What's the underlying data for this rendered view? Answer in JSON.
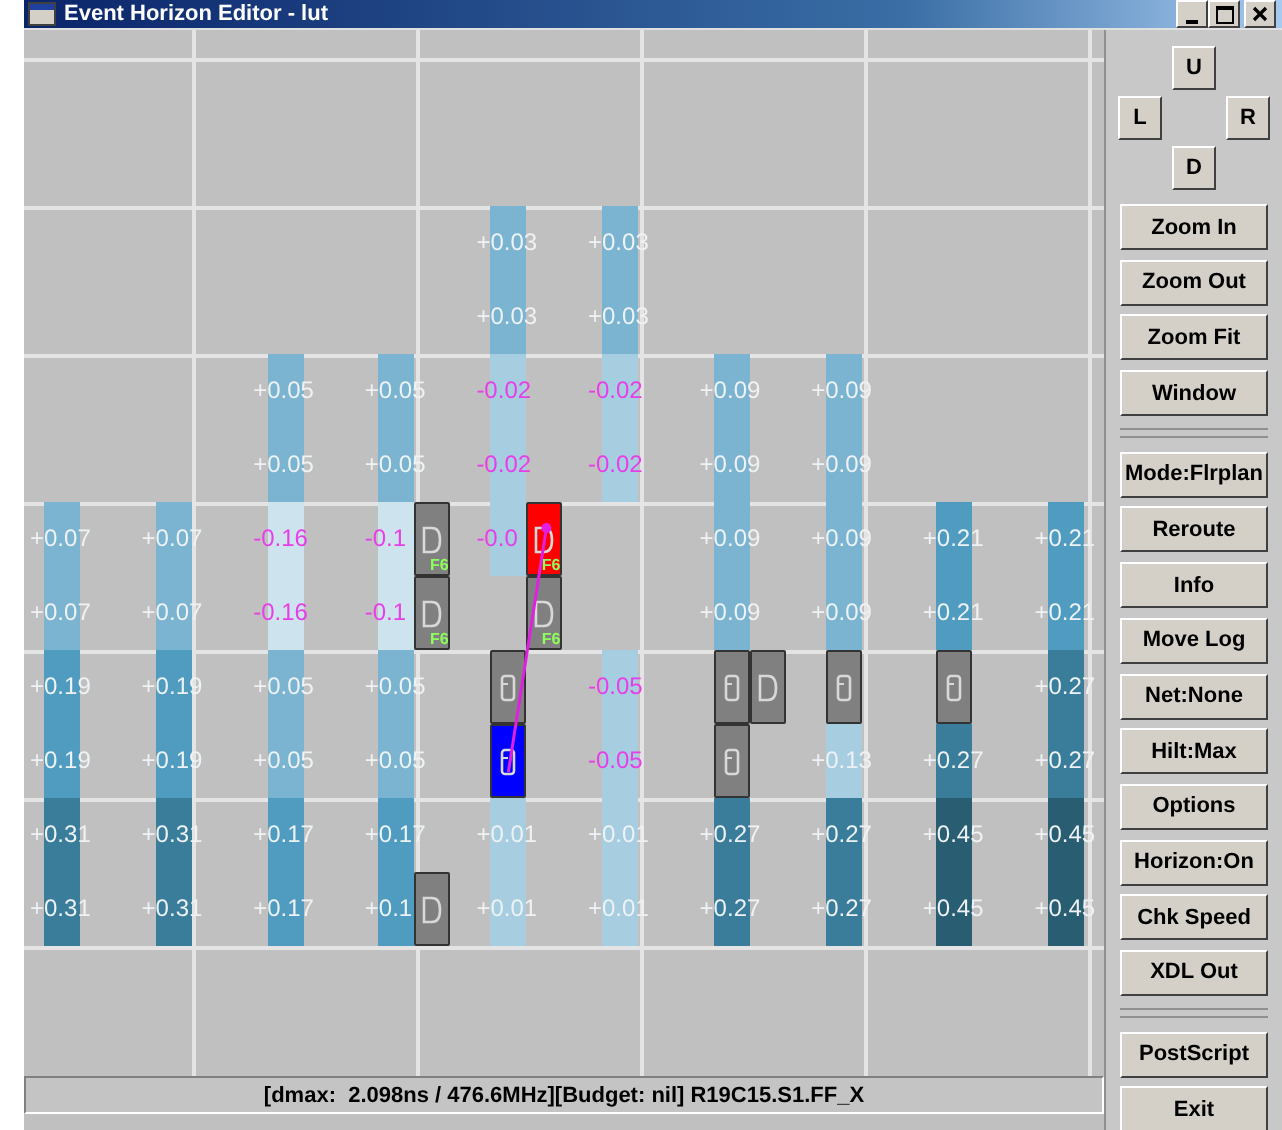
{
  "window": {
    "title": "Event Horizon Editor - lut"
  },
  "columns": [
    {
      "cells": [
        {
          "kind": "empty"
        },
        {
          "kind": "empty"
        },
        {
          "kind": "empty"
        },
        {
          "kind": "empty"
        },
        {
          "kind": "empty"
        },
        {
          "kind": "empty"
        },
        {
          "kind": "bar",
          "value": "+0.07",
          "color": "#7ab4d0",
          "negative": false
        },
        {
          "kind": "bar",
          "value": "+0.07",
          "color": "#7ab4d0",
          "negative": false
        },
        {
          "kind": "bar",
          "value": "+0.19",
          "color": "#4f9cc0",
          "negative": false
        },
        {
          "kind": "bar",
          "value": "+0.19",
          "color": "#4f9cc0",
          "negative": false
        },
        {
          "kind": "bar",
          "value": "+0.31",
          "color": "#3a7d9b",
          "negative": false
        },
        {
          "kind": "bar",
          "value": "+0.31",
          "color": "#3a7d9b",
          "negative": false
        }
      ]
    },
    {
      "cells": [
        {
          "kind": "empty"
        },
        {
          "kind": "empty"
        },
        {
          "kind": "empty"
        },
        {
          "kind": "empty"
        },
        {
          "kind": "empty"
        },
        {
          "kind": "empty"
        },
        {
          "kind": "bar",
          "value": "+0.07",
          "color": "#7ab4d0",
          "negative": false
        },
        {
          "kind": "bar",
          "value": "+0.07",
          "color": "#7ab4d0",
          "negative": false
        },
        {
          "kind": "bar",
          "value": "+0.19",
          "color": "#4f9cc0",
          "negative": false
        },
        {
          "kind": "bar",
          "value": "+0.19",
          "color": "#4f9cc0",
          "negative": false
        },
        {
          "kind": "bar",
          "value": "+0.31",
          "color": "#3a7d9b",
          "negative": false
        },
        {
          "kind": "bar",
          "value": "+0.31",
          "color": "#3a7d9b",
          "negative": false
        }
      ]
    },
    {
      "cells": [
        {
          "kind": "empty"
        },
        {
          "kind": "empty"
        },
        {
          "kind": "empty"
        },
        {
          "kind": "empty"
        },
        {
          "kind": "bar",
          "value": "+0.05",
          "color": "#7ab4d0",
          "negative": false
        },
        {
          "kind": "bar",
          "value": "+0.05",
          "color": "#7ab4d0",
          "negative": false
        },
        {
          "kind": "bar",
          "value": "-0.16",
          "color": "#cde3ed",
          "negative": true
        },
        {
          "kind": "bar",
          "value": "-0.16",
          "color": "#cde3ed",
          "negative": true
        },
        {
          "kind": "bar",
          "value": "+0.05",
          "color": "#7ab4d0",
          "negative": false
        },
        {
          "kind": "bar",
          "value": "+0.05",
          "color": "#7ab4d0",
          "negative": false
        },
        {
          "kind": "bar",
          "value": "+0.17",
          "color": "#4f9cc0",
          "negative": false
        },
        {
          "kind": "bar",
          "value": "+0.17",
          "color": "#4f9cc0",
          "negative": false
        }
      ]
    },
    {
      "cells": [
        {
          "kind": "empty"
        },
        {
          "kind": "empty"
        },
        {
          "kind": "empty"
        },
        {
          "kind": "empty"
        },
        {
          "kind": "bar",
          "value": "+0.05",
          "color": "#7ab4d0",
          "negative": false
        },
        {
          "kind": "bar",
          "value": "+0.05",
          "color": "#7ab4d0",
          "negative": false
        },
        {
          "kind": "bar",
          "value": "-0.1",
          "color": "#cde3ed",
          "negative": true,
          "beside": {
            "kind": "buffer",
            "color": "#808080",
            "tag": "F6",
            "on_net": false
          }
        },
        {
          "kind": "bar",
          "value": "-0.1",
          "color": "#cde3ed",
          "negative": true,
          "beside": {
            "kind": "buffer",
            "color": "#808080",
            "tag": "F6",
            "on_net": false
          }
        },
        {
          "kind": "bar",
          "value": "+0.05",
          "color": "#7ab4d0",
          "negative": false
        },
        {
          "kind": "bar",
          "value": "+0.05",
          "color": "#7ab4d0",
          "negative": false
        },
        {
          "kind": "bar",
          "value": "+0.17",
          "color": "#4f9cc0",
          "negative": false
        },
        {
          "kind": "bar",
          "value": "+0.1",
          "color": "#4f9cc0",
          "negative": false,
          "beside": {
            "kind": "buffer",
            "color": "#808080",
            "on_net": false
          }
        }
      ]
    },
    {
      "cells": [
        {
          "kind": "empty"
        },
        {
          "kind": "empty"
        },
        {
          "kind": "bar",
          "value": "+0.03",
          "color": "#7ab4d0",
          "negative": false
        },
        {
          "kind": "bar",
          "value": "+0.03",
          "color": "#7ab4d0",
          "negative": false
        },
        {
          "kind": "bar",
          "value": "-0.02",
          "color": "#a6cde0",
          "negative": true
        },
        {
          "kind": "bar",
          "value": "-0.02",
          "color": "#a6cde0",
          "negative": true
        },
        {
          "kind": "bar",
          "value": "-0.0",
          "color": "#a6cde0",
          "negative": true,
          "beside": {
            "kind": "buffer",
            "color": "#ff0000",
            "tag": "F6",
            "on_net": true
          }
        },
        {
          "kind": "empty",
          "beside": {
            "kind": "buffer",
            "color": "#808080",
            "tag": "F6",
            "on_net": false
          }
        },
        {
          "kind": "latch",
          "color": "#808080",
          "on_net": false
        },
        {
          "kind": "latch",
          "color": "#0000ff",
          "on_net": true
        },
        {
          "kind": "bar",
          "value": "+0.01",
          "color": "#a6cde0",
          "negative": false
        },
        {
          "kind": "bar",
          "value": "+0.01",
          "color": "#a6cde0",
          "negative": false
        }
      ]
    },
    {
      "cells": [
        {
          "kind": "empty"
        },
        {
          "kind": "empty"
        },
        {
          "kind": "bar",
          "value": "+0.03",
          "color": "#7ab4d0",
          "negative": false
        },
        {
          "kind": "bar",
          "value": "+0.03",
          "color": "#7ab4d0",
          "negative": false
        },
        {
          "kind": "bar",
          "value": "-0.02",
          "color": "#a6cde0",
          "negative": true
        },
        {
          "kind": "bar",
          "value": "-0.02",
          "color": "#a6cde0",
          "negative": true
        },
        {
          "kind": "empty"
        },
        {
          "kind": "empty"
        },
        {
          "kind": "bar",
          "value": "-0.05",
          "color": "#a6cde0",
          "negative": true
        },
        {
          "kind": "bar",
          "value": "-0.05",
          "color": "#a6cde0",
          "negative": true
        },
        {
          "kind": "bar",
          "value": "+0.01",
          "color": "#a6cde0",
          "negative": false
        },
        {
          "kind": "bar",
          "value": "+0.01",
          "color": "#a6cde0",
          "negative": false
        }
      ]
    },
    {
      "cells": [
        {
          "kind": "empty"
        },
        {
          "kind": "empty"
        },
        {
          "kind": "empty"
        },
        {
          "kind": "empty"
        },
        {
          "kind": "bar",
          "value": "+0.09",
          "color": "#7ab4d0",
          "negative": false
        },
        {
          "kind": "bar",
          "value": "+0.09",
          "color": "#7ab4d0",
          "negative": false
        },
        {
          "kind": "bar",
          "value": "+0.09",
          "color": "#7ab4d0",
          "negative": false
        },
        {
          "kind": "bar",
          "value": "+0.09",
          "color": "#7ab4d0",
          "negative": false
        },
        {
          "kind": "latch",
          "color": "#808080",
          "on_net": false,
          "beside": {
            "kind": "buffer",
            "color": "#808080",
            "on_net": false
          }
        },
        {
          "kind": "latch",
          "color": "#808080",
          "on_net": false
        },
        {
          "kind": "bar",
          "value": "+0.27",
          "color": "#3a7d9b",
          "negative": false
        },
        {
          "kind": "bar",
          "value": "+0.27",
          "color": "#3a7d9b",
          "negative": false
        }
      ]
    },
    {
      "cells": [
        {
          "kind": "empty"
        },
        {
          "kind": "empty"
        },
        {
          "kind": "empty"
        },
        {
          "kind": "empty"
        },
        {
          "kind": "bar",
          "value": "+0.09",
          "color": "#7ab4d0",
          "negative": false
        },
        {
          "kind": "bar",
          "value": "+0.09",
          "color": "#7ab4d0",
          "negative": false
        },
        {
          "kind": "bar",
          "value": "+0.09",
          "color": "#7ab4d0",
          "negative": false
        },
        {
          "kind": "bar",
          "value": "+0.09",
          "color": "#7ab4d0",
          "negative": false
        },
        {
          "kind": "latch",
          "color": "#808080",
          "on_net": false
        },
        {
          "kind": "bar",
          "value": "+0.13",
          "color": "#a6cde0",
          "negative": false
        },
        {
          "kind": "bar",
          "value": "+0.27",
          "color": "#3a7d9b",
          "negative": false
        },
        {
          "kind": "bar",
          "value": "+0.27",
          "color": "#3a7d9b",
          "negative": false
        }
      ]
    },
    {
      "cells": [
        {
          "kind": "empty"
        },
        {
          "kind": "empty"
        },
        {
          "kind": "empty"
        },
        {
          "kind": "empty"
        },
        {
          "kind": "empty"
        },
        {
          "kind": "empty"
        },
        {
          "kind": "bar",
          "value": "+0.21",
          "color": "#4f9cc0",
          "negative": false
        },
        {
          "kind": "bar",
          "value": "+0.21",
          "color": "#4f9cc0",
          "negative": false
        },
        {
          "kind": "latch",
          "color": "#808080",
          "on_net": false
        },
        {
          "kind": "bar",
          "value": "+0.27",
          "color": "#3a7d9b",
          "negative": false
        },
        {
          "kind": "bar",
          "value": "+0.45",
          "color": "#285d72",
          "negative": false
        },
        {
          "kind": "bar",
          "value": "+0.45",
          "color": "#285d72",
          "negative": false
        }
      ]
    },
    {
      "cells": [
        {
          "kind": "empty"
        },
        {
          "kind": "empty"
        },
        {
          "kind": "empty"
        },
        {
          "kind": "empty"
        },
        {
          "kind": "empty"
        },
        {
          "kind": "empty"
        },
        {
          "kind": "bar",
          "value": "+0.21",
          "color": "#4f9cc0",
          "negative": false
        },
        {
          "kind": "bar",
          "value": "+0.21",
          "color": "#4f9cc0",
          "negative": false
        },
        {
          "kind": "bar",
          "value": "+0.27",
          "color": "#3a7d9b",
          "negative": false
        },
        {
          "kind": "bar",
          "value": "+0.27",
          "color": "#3a7d9b",
          "negative": false
        },
        {
          "kind": "bar",
          "value": "+0.45",
          "color": "#285d72",
          "negative": false
        },
        {
          "kind": "bar",
          "value": "+0.45",
          "color": "#285d72",
          "negative": false
        }
      ]
    }
  ],
  "pad": {
    "up": "U",
    "left": "L",
    "right": "R",
    "down": "D"
  },
  "controls": [
    {
      "kind": "button",
      "label": "Zoom In"
    },
    {
      "kind": "button",
      "label": "Zoom Out"
    },
    {
      "kind": "button",
      "label": "Zoom Fit"
    },
    {
      "kind": "button",
      "label": "Window"
    },
    {
      "kind": "separator"
    },
    {
      "kind": "button",
      "label": "Mode:Flrplan"
    },
    {
      "kind": "button",
      "label": "Reroute"
    },
    {
      "kind": "button",
      "label": "Info"
    },
    {
      "kind": "button",
      "label": "Move Log"
    },
    {
      "kind": "button",
      "label": "Net:None"
    },
    {
      "kind": "button",
      "label": "Hilt:Max"
    },
    {
      "kind": "button",
      "label": "Options"
    },
    {
      "kind": "button",
      "label": "Horizon:On"
    },
    {
      "kind": "button",
      "label": "Chk Speed"
    },
    {
      "kind": "button",
      "label": "XDL Out"
    },
    {
      "kind": "separator"
    },
    {
      "kind": "button",
      "label": "PostScript"
    },
    {
      "kind": "button",
      "label": "Exit"
    }
  ],
  "status_bar": "[dmax:  2.098ns / 476.6MHz][Budget: nil] R19C15.S1.FF_X"
}
